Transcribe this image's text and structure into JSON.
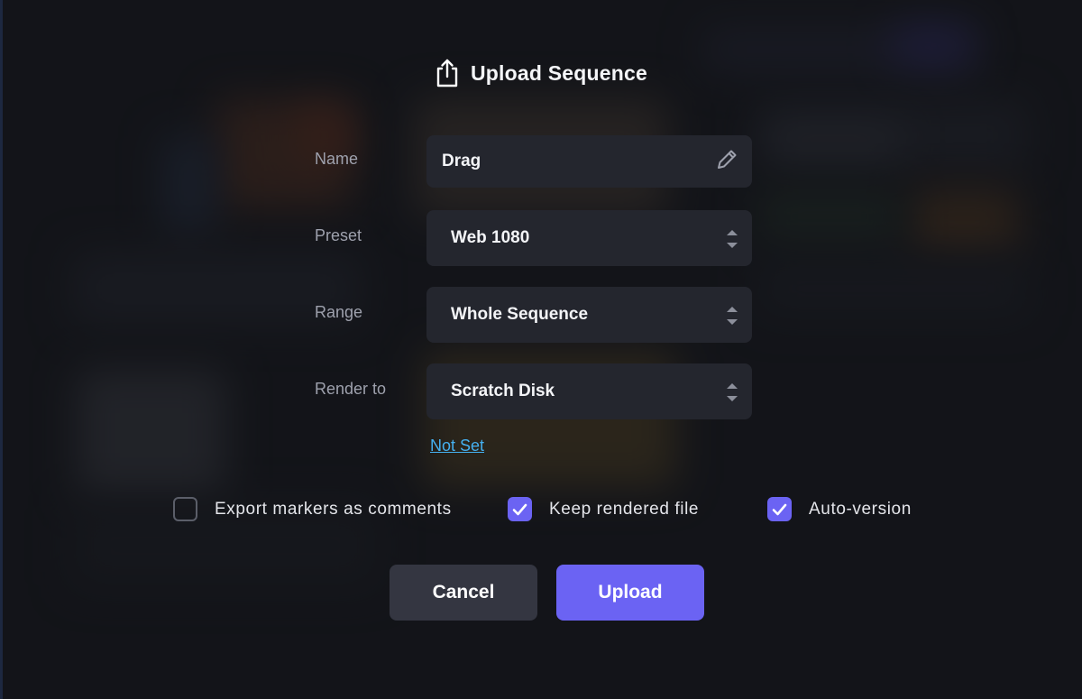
{
  "dialog": {
    "title": "Upload Sequence",
    "title_icon": "share-upload-icon",
    "name": {
      "label": "Name",
      "value": "Drag",
      "icon": "pencil-edit-icon"
    },
    "preset": {
      "label": "Preset",
      "value": "Web 1080"
    },
    "range": {
      "label": "Range",
      "value": "Whole Sequence"
    },
    "render_to": {
      "label": "Render to",
      "value": "Scratch Disk",
      "link": "Not Set"
    },
    "options": {
      "export_markers": {
        "label": "Export markers as comments",
        "checked": false
      },
      "keep_rendered": {
        "label": "Keep rendered file",
        "checked": true
      },
      "auto_version": {
        "label": "Auto-version",
        "checked": true
      }
    },
    "buttons": {
      "cancel": "Cancel",
      "upload": "Upload"
    }
  },
  "colors": {
    "accent": "#6b63f3",
    "field_bg": "#24262e",
    "cancel_bg": "#343641",
    "link": "#45b0f0",
    "label": "#9ea1ad"
  }
}
